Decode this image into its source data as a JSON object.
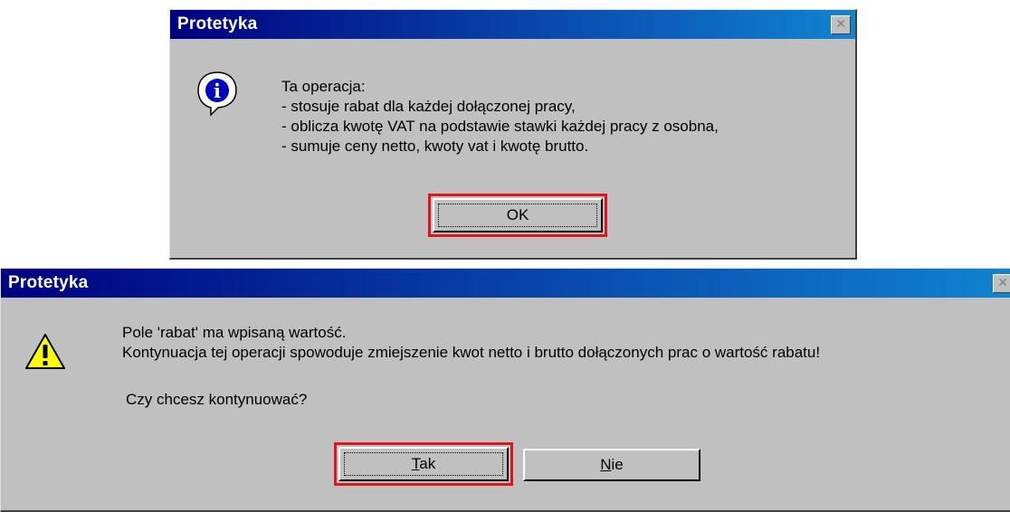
{
  "dialog1": {
    "title": "Protetyka",
    "icon": "info-icon",
    "message": "Ta operacja:\n- stosuje rabat dla każdej dołączonej pracy,\n- oblicza kwotę VAT na podstawie stawki każdej pracy z osobna,\n- sumuje ceny netto, kwoty vat i kwotę brutto.",
    "ok_label": "OK"
  },
  "dialog2": {
    "title": "Protetyka",
    "icon": "warning-icon",
    "message": "Pole 'rabat' ma wpisaną wartość.\nKontynuacja tej operacji spowoduje zmiejszenie kwot netto i brutto dołączonych prac o wartość rabatu!",
    "question": "Czy chcesz kontynuować?",
    "yes_label_mnemonic": "T",
    "yes_label_rest": "ak",
    "no_label_mnemonic": "N",
    "no_label_rest": "ie"
  },
  "colors": {
    "titlebar_start": "#000080",
    "titlebar_end": "#1084d0",
    "highlight": "#e0141c",
    "dialog_bg": "#c0c0c0"
  }
}
